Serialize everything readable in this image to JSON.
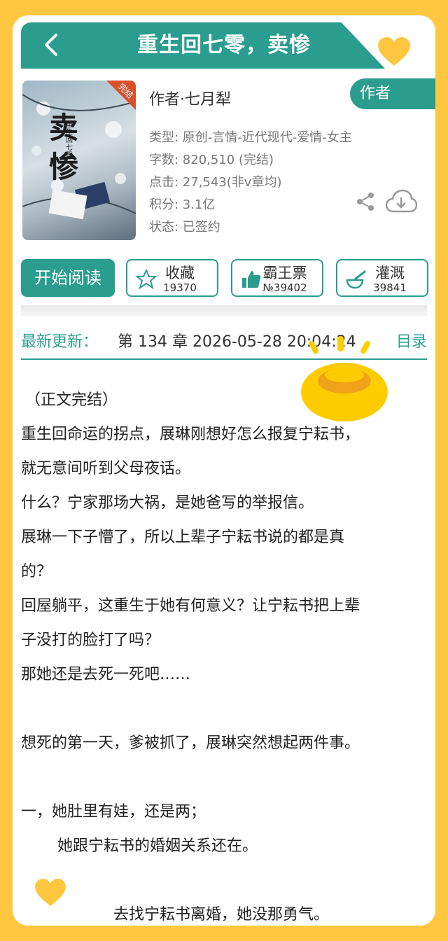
{
  "header": {
    "title": "重生回七零，卖惨"
  },
  "book": {
    "cover_badge": "完结",
    "cover_title": "卖惨",
    "cover_subtitle": "重生回七零",
    "author": "作者·七月犁",
    "author_pill": "作者",
    "type": "类型: 原创-言情-近代现代-爱情-女主",
    "words": "字数: 820,510 (完结)",
    "clicks": "点击: 27,543(非v章均)",
    "score": "积分: 3.1亿",
    "status": "状态: 已签约"
  },
  "actions": {
    "start_reading": "开始阅读",
    "favorite": {
      "label": "收藏",
      "count": "19370"
    },
    "ticket": {
      "label": "霸王票",
      "count": "№39402"
    },
    "water": {
      "label": "灌溉",
      "count": "39841"
    }
  },
  "latest": {
    "label": "最新更新：",
    "value": "第 134 章  2026-05-28 20:04:24",
    "toc": "目录"
  },
  "synopsis": [
    "（正文完结）",
    "重生回命运的拐点，展琳刚想好怎么报复宁耘书，",
    "就无意间听到父母夜话。",
    "什么？宁家那场大祸，是她爸写的举报信。",
    "展琳一下子懵了，所以上辈子宁耘书说的都是真",
    "的？",
    "回屋躺平，这重生于她有何意义？让宁耘书把上辈",
    "子没打的脸打了吗？",
    "那她还是去死一死吧……",
    "",
    "想死的第一天，爹被抓了，展琳突然想起两件事。",
    "",
    "一，她肚里有娃，还是两；",
    "她跟宁耘书的婚姻关系还在。",
    "",
    "去找宁耘书离婚，她没那勇气。"
  ],
  "colors": {
    "accent": "#2a9d8f",
    "background": "#ffc740",
    "heart": "#ffc740"
  }
}
